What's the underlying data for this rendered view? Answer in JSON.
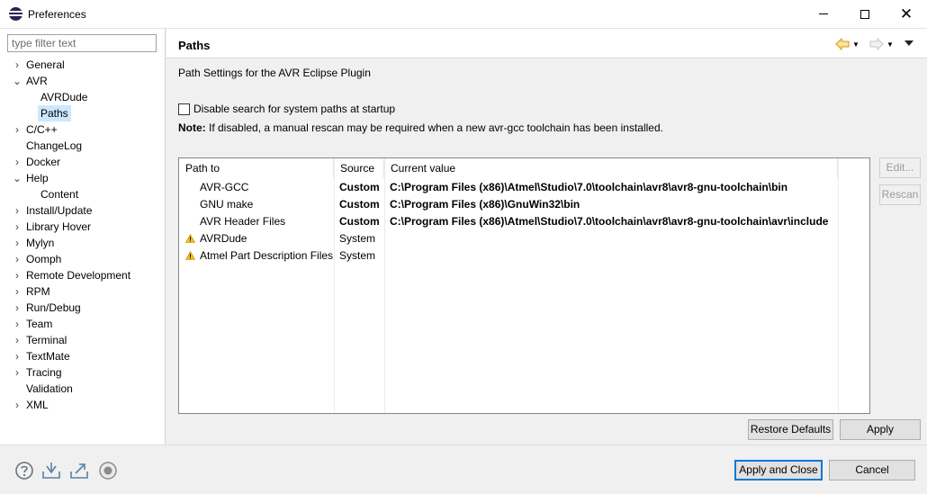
{
  "window": {
    "title": "Preferences",
    "minimize_icon": "minimize-icon",
    "maximize_icon": "maximize-icon",
    "close_icon": "close-icon",
    "close_glyph": "✕"
  },
  "sidebar": {
    "filter_placeholder": "type filter text",
    "items": [
      {
        "label": "General",
        "expander": "›",
        "level": 0
      },
      {
        "label": "AVR",
        "expander": "⌄",
        "level": 0
      },
      {
        "label": "AVRDude",
        "expander": "",
        "level": 1
      },
      {
        "label": "Paths",
        "expander": "",
        "level": 1,
        "selected": true
      },
      {
        "label": "C/C++",
        "expander": "›",
        "level": 0
      },
      {
        "label": "ChangeLog",
        "expander": "",
        "level": 0
      },
      {
        "label": "Docker",
        "expander": "›",
        "level": 0
      },
      {
        "label": "Help",
        "expander": "⌄",
        "level": 0
      },
      {
        "label": "Content",
        "expander": "",
        "level": 1
      },
      {
        "label": "Install/Update",
        "expander": "›",
        "level": 0
      },
      {
        "label": "Library Hover",
        "expander": "›",
        "level": 0
      },
      {
        "label": "Mylyn",
        "expander": "›",
        "level": 0
      },
      {
        "label": "Oomph",
        "expander": "›",
        "level": 0
      },
      {
        "label": "Remote Development",
        "expander": "›",
        "level": 0
      },
      {
        "label": "RPM",
        "expander": "›",
        "level": 0
      },
      {
        "label": "Run/Debug",
        "expander": "›",
        "level": 0
      },
      {
        "label": "Team",
        "expander": "›",
        "level": 0
      },
      {
        "label": "Terminal",
        "expander": "›",
        "level": 0
      },
      {
        "label": "TextMate",
        "expander": "›",
        "level": 0
      },
      {
        "label": "Tracing",
        "expander": "›",
        "level": 0
      },
      {
        "label": "Validation",
        "expander": "",
        "level": 0
      },
      {
        "label": "XML",
        "expander": "›",
        "level": 0
      }
    ]
  },
  "page": {
    "title": "Paths",
    "description": "Path Settings for the AVR Eclipse Plugin",
    "checkbox_label": "Disable search for system paths at startup",
    "checkbox_checked": false,
    "note_label": "Note:",
    "note_text": " If disabled, a manual rescan may be required when a new avr-gcc toolchain has been installed.",
    "nav": {
      "back_icon": "back-arrow-icon",
      "forward_icon": "forward-arrow-icon",
      "menu_icon": "view-menu-icon",
      "dropdown_glyph": "▼"
    },
    "table": {
      "headers": [
        "Path to",
        "Source",
        "Current value"
      ],
      "rows": [
        {
          "name": "AVR-GCC",
          "source": "Custom",
          "value": "C:\\Program Files (x86)\\Atmel\\Studio\\7.0\\toolchain\\avr8\\avr8-gnu-toolchain\\bin",
          "warning": false
        },
        {
          "name": "GNU make",
          "source": "Custom",
          "value": "C:\\Program Files (x86)\\GnuWin32\\bin",
          "warning": false
        },
        {
          "name": "AVR Header Files",
          "source": "Custom",
          "value": "C:\\Program Files (x86)\\Atmel\\Studio\\7.0\\toolchain\\avr8\\avr8-gnu-toolchain\\avr\\include",
          "warning": false
        },
        {
          "name": "AVRDude",
          "source": "System",
          "value": "",
          "warning": true
        },
        {
          "name": "Atmel Part Description Files",
          "source": "System",
          "value": "",
          "warning": true
        }
      ]
    },
    "edit_label": "Edit...",
    "rescan_label": "Rescan",
    "restore_defaults_label": "Restore Defaults",
    "apply_label": "Apply"
  },
  "footer": {
    "icons": [
      "help-icon",
      "import-icon",
      "export-icon",
      "record-icon"
    ],
    "apply_close_label": "Apply and Close",
    "cancel_label": "Cancel"
  },
  "colors": {
    "selection": "#cce8ff",
    "warning": "#f2c019",
    "accent": "#0078d7",
    "nav_arrow": "#e8b019"
  }
}
